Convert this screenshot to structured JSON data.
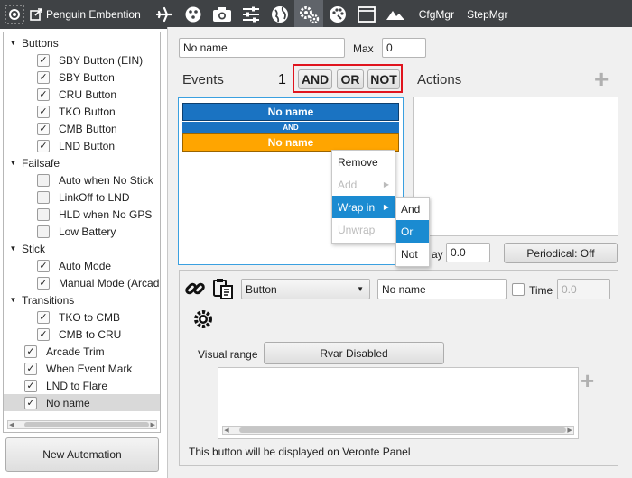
{
  "toolbar": {
    "app_title": "Penguin Embention",
    "text_items": [
      "CfgMgr",
      "StepMgr"
    ]
  },
  "tree": [
    {
      "type": "group",
      "label": "Buttons"
    },
    {
      "type": "item",
      "label": "SBY Button (EIN)",
      "checked": true,
      "indent": 2
    },
    {
      "type": "item",
      "label": "SBY Button",
      "checked": true,
      "indent": 2
    },
    {
      "type": "item",
      "label": "CRU Button",
      "checked": true,
      "indent": 2
    },
    {
      "type": "item",
      "label": "TKO Button",
      "checked": true,
      "indent": 2
    },
    {
      "type": "item",
      "label": "CMB Button",
      "checked": true,
      "indent": 2
    },
    {
      "type": "item",
      "label": "LND Button",
      "checked": true,
      "indent": 2
    },
    {
      "type": "group",
      "label": "Failsafe"
    },
    {
      "type": "item",
      "label": "Auto when No Stick",
      "checked": false,
      "indent": 2
    },
    {
      "type": "item",
      "label": "LinkOff to LND",
      "checked": false,
      "indent": 2
    },
    {
      "type": "item",
      "label": "HLD when No GPS",
      "checked": false,
      "indent": 2
    },
    {
      "type": "item",
      "label": "Low Battery",
      "checked": false,
      "indent": 2
    },
    {
      "type": "group",
      "label": "Stick"
    },
    {
      "type": "item",
      "label": "Auto Mode",
      "checked": true,
      "indent": 2
    },
    {
      "type": "item",
      "label": "Manual Mode (Arcad",
      "checked": true,
      "indent": 2
    },
    {
      "type": "group",
      "label": "Transitions"
    },
    {
      "type": "item",
      "label": "TKO to CMB",
      "checked": true,
      "indent": 2
    },
    {
      "type": "item",
      "label": "CMB to CRU",
      "checked": true,
      "indent": 2
    },
    {
      "type": "item",
      "label": "Arcade Trim",
      "checked": true,
      "indent": 1
    },
    {
      "type": "item",
      "label": "When Event Mark",
      "checked": true,
      "indent": 1
    },
    {
      "type": "item",
      "label": "LND to Flare",
      "checked": true,
      "indent": 1
    },
    {
      "type": "item",
      "label": "No name",
      "checked": true,
      "indent": 1,
      "selected": true
    }
  ],
  "new_automation_label": "New Automation",
  "automation": {
    "name": "No name",
    "max_label": "Max",
    "max_value": "0"
  },
  "events": {
    "title": "Events",
    "annotation": "1",
    "ops": [
      "AND",
      "OR",
      "NOT"
    ],
    "first_event": "No name",
    "connector": "AND",
    "second_event": "No name"
  },
  "actions": {
    "title": "Actions"
  },
  "delay": {
    "label_partial": "ay",
    "value": "0.0",
    "periodical_label": "Periodical: Off"
  },
  "context_menu": {
    "items": [
      "Remove",
      "Add",
      "Wrap in",
      "Unwrap"
    ],
    "submenu": [
      "And",
      "Or",
      "Not"
    ]
  },
  "event_config": {
    "type": "Button",
    "name": "No name",
    "time_label": "Time",
    "time_value": "0.0",
    "visual_range_label": "Visual range",
    "rvar_button": "Rvar Disabled",
    "footer": "This button will be displayed on Veronte Panel"
  },
  "colors": {
    "event_blue": "#1a73c2",
    "event_orange": "#ffa500",
    "highlight": "#1b8bd1",
    "annotation_red": "#e0141e"
  }
}
